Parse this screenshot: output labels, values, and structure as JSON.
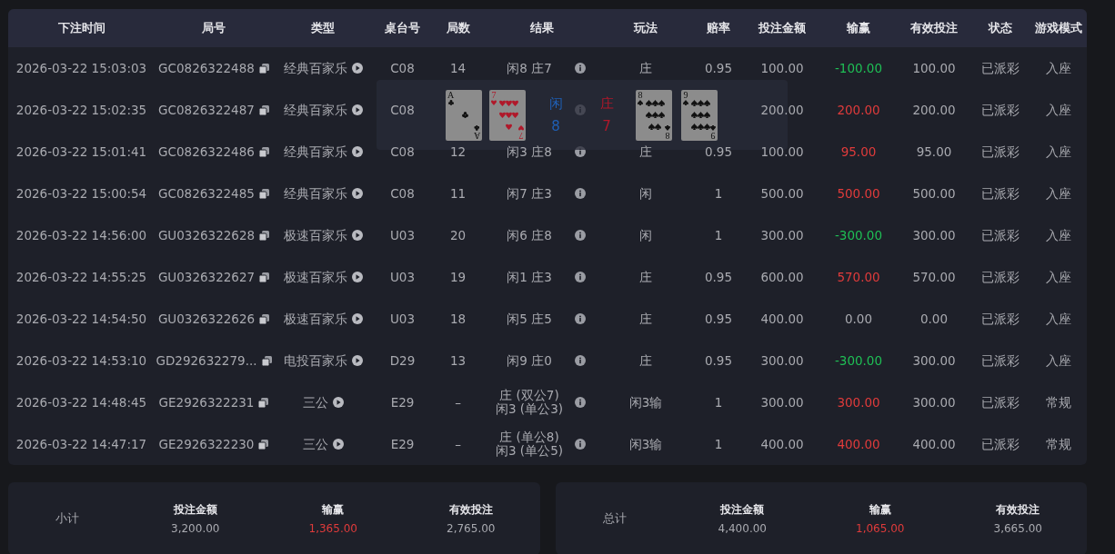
{
  "table": {
    "columns": [
      "下注时间",
      "局号",
      "类型",
      "桌台号",
      "局数",
      "结果",
      "玩法",
      "赔率",
      "投注金额",
      "输赢",
      "有效投注",
      "状态",
      "游戏模式"
    ],
    "rows": [
      {
        "time": "2026-03-22 15:03:03",
        "round_id": "GC0826322488",
        "game": "经典百家乐",
        "table": "C08",
        "round": "14",
        "result": [
          "闲8 庄7"
        ],
        "bet_on": "庄",
        "odds": "0.95",
        "amount": "100.00",
        "win_loss": "-100.00",
        "color": "#1fbf55",
        "valid": "100.00",
        "status": "已派彩",
        "mode": "入座"
      },
      {
        "time": "2026-03-22 15:02:35",
        "round_id": "GC0826322487",
        "game": "经典百家乐",
        "table": "C08",
        "amount": "200.00",
        "win_loss": "200.00",
        "color": "#e03b3b",
        "valid": "200.00",
        "status": "已派彩",
        "mode": "入座"
      },
      {
        "time": "2026-03-22 15:01:41",
        "round_id": "GC0826322486",
        "game": "经典百家乐",
        "table": "C08",
        "round": "12",
        "result": [
          "闲3 庄8"
        ],
        "bet_on": "庄",
        "odds": "0.95",
        "amount": "100.00",
        "win_loss": "95.00",
        "color": "#e03b3b",
        "valid": "95.00",
        "status": "已派彩",
        "mode": "入座"
      },
      {
        "time": "2026-03-22 15:00:54",
        "round_id": "GC0826322485",
        "game": "经典百家乐",
        "table": "C08",
        "round": "11",
        "result": [
          "闲7 庄3"
        ],
        "bet_on": "闲",
        "odds": "1",
        "amount": "500.00",
        "win_loss": "500.00",
        "color": "#e03b3b",
        "valid": "500.00",
        "status": "已派彩",
        "mode": "入座"
      },
      {
        "time": "2026-03-22 14:56:00",
        "round_id": "GU0326322628",
        "game": "极速百家乐",
        "table": "U03",
        "round": "20",
        "result": [
          "闲6 庄8"
        ],
        "bet_on": "闲",
        "odds": "1",
        "amount": "300.00",
        "win_loss": "-300.00",
        "color": "#1fbf55",
        "valid": "300.00",
        "status": "已派彩",
        "mode": "入座"
      },
      {
        "time": "2026-03-22 14:55:25",
        "round_id": "GU0326322627",
        "game": "极速百家乐",
        "table": "U03",
        "round": "19",
        "result": [
          "闲1 庄3"
        ],
        "bet_on": "庄",
        "odds": "0.95",
        "amount": "600.00",
        "win_loss": "570.00",
        "color": "#e03b3b",
        "valid": "570.00",
        "status": "已派彩",
        "mode": "入座"
      },
      {
        "time": "2026-03-22 14:54:50",
        "round_id": "GU0326322626",
        "game": "极速百家乐",
        "table": "U03",
        "round": "18",
        "result": [
          "闲5 庄5"
        ],
        "bet_on": "庄",
        "odds": "0.95",
        "amount": "400.00",
        "win_loss": "0.00",
        "color": "#a9aab0",
        "valid": "0.00",
        "status": "已派彩",
        "mode": "入座"
      },
      {
        "time": "2026-03-22 14:53:10",
        "round_id": "GD292632279...",
        "game": "电投百家乐",
        "table": "D29",
        "round": "13",
        "result": [
          "闲9 庄0"
        ],
        "bet_on": "庄",
        "odds": "0.95",
        "amount": "300.00",
        "win_loss": "-300.00",
        "color": "#1fbf55",
        "valid": "300.00",
        "status": "已派彩",
        "mode": "入座"
      },
      {
        "time": "2026-03-22 14:48:45",
        "round_id": "GE2926322231",
        "game": "三公",
        "table": "E29",
        "round": "–",
        "result": [
          "庄 (双公7)",
          "闲3 (单公3)"
        ],
        "bet_on": "闲3输",
        "odds": "1",
        "amount": "300.00",
        "win_loss": "300.00",
        "color": "#e03b3b",
        "valid": "300.00",
        "status": "已派彩",
        "mode": "常规"
      },
      {
        "time": "2026-03-22 14:47:17",
        "round_id": "GE2926322230",
        "game": "三公",
        "table": "E29",
        "round": "–",
        "result": [
          "庄 (单公8)",
          "闲3 (单公5)"
        ],
        "bet_on": "闲3输",
        "odds": "1",
        "amount": "400.00",
        "win_loss": "400.00",
        "color": "#e03b3b",
        "valid": "400.00",
        "status": "已派彩",
        "mode": "常规"
      }
    ]
  },
  "popover": {
    "sides": [
      {
        "kind": "player",
        "label": "闲",
        "score": "8",
        "cards": [
          {
            "ranks": [
              "A",
              "A"
            ],
            "kind": "club"
          },
          {
            "ranks": [
              "7",
              "7"
            ],
            "kind": "heart"
          }
        ]
      },
      {
        "kind": "banker",
        "label": "庄",
        "score": "7",
        "cards": [
          {
            "ranks": [
              "8",
              "8"
            ],
            "kind": "spade"
          },
          {
            "ranks": [
              "9",
              "9"
            ],
            "kind": "spade"
          }
        ]
      }
    ]
  },
  "summaries": [
    {
      "label": "小计",
      "items": [
        {
          "label": "投注金额",
          "value": "3,200.00",
          "color": "#a9aab0"
        },
        {
          "label": "输赢",
          "value": "1,365.00",
          "color": "#e03b3b"
        },
        {
          "label": "有效投注",
          "value": "2,765.00",
          "color": "#a9aab0"
        }
      ]
    },
    {
      "label": "总计",
      "items": [
        {
          "label": "投注金额",
          "value": "4,400.00",
          "color": "#a9aab0"
        },
        {
          "label": "输赢",
          "value": "1,065.00",
          "color": "#e03b3b"
        },
        {
          "label": "有效投注",
          "value": "3,665.00",
          "color": "#a9aab0"
        }
      ]
    }
  ]
}
